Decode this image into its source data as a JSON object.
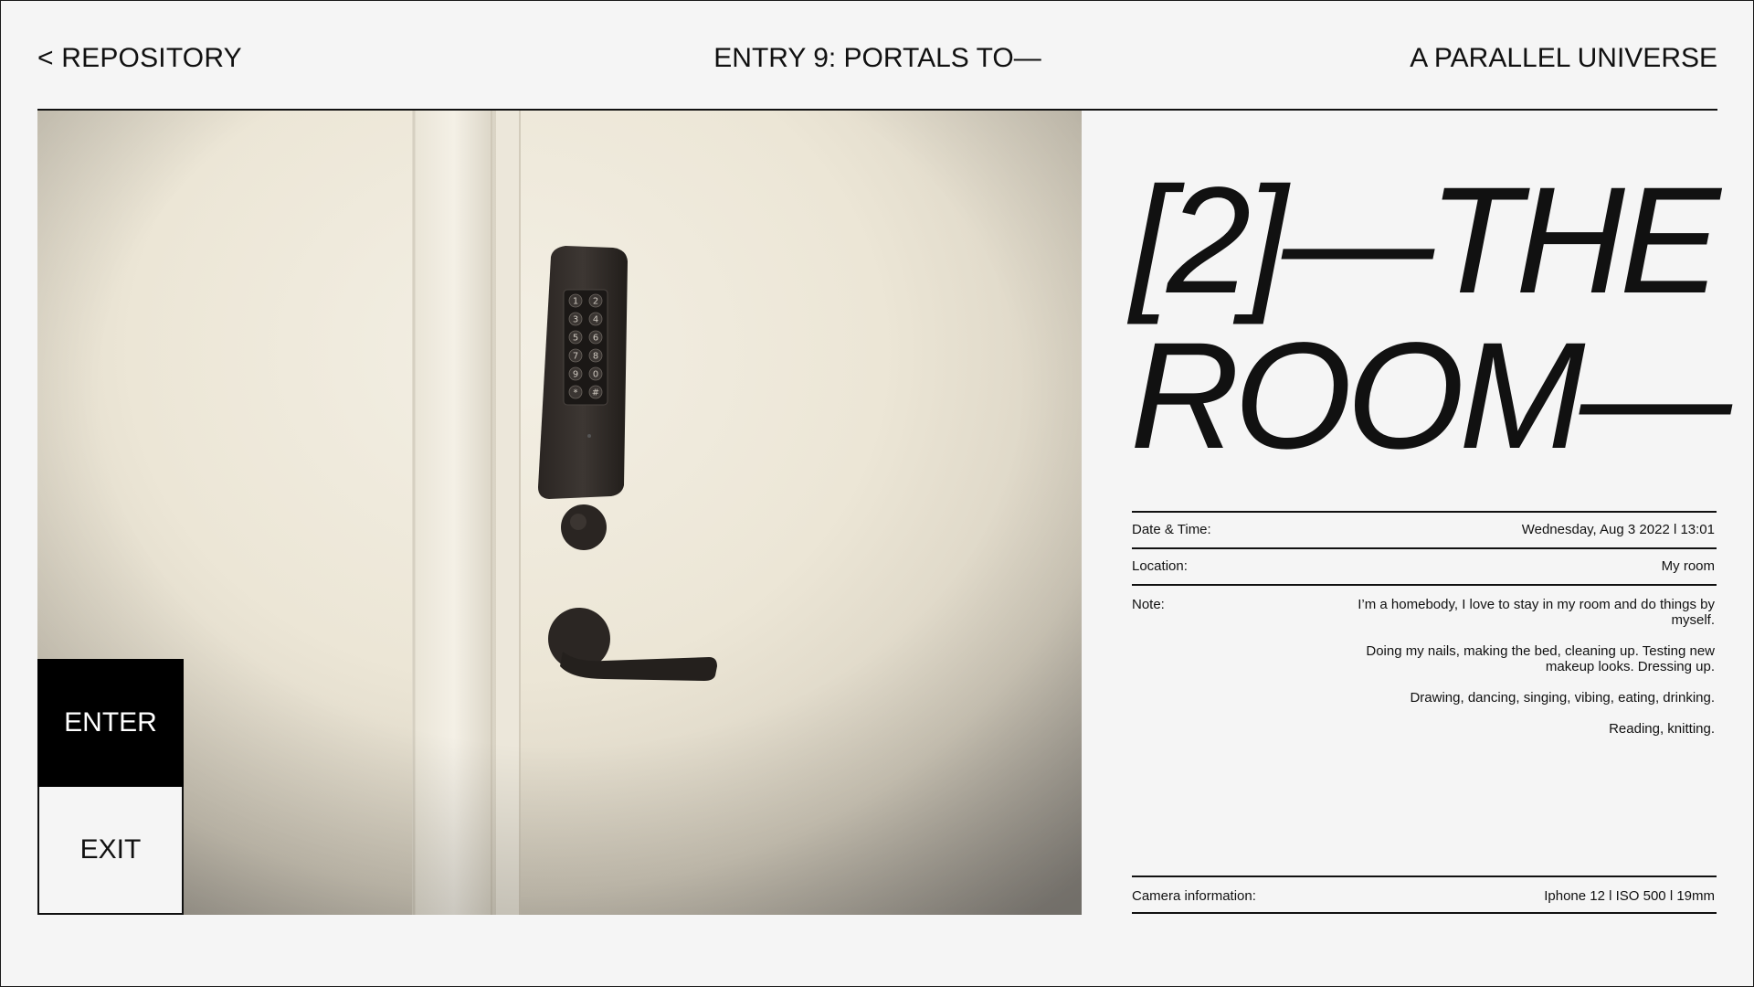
{
  "header": {
    "back_label": "< REPOSITORY",
    "entry_title": "ENTRY 9: PORTALS TO—",
    "site_name": "A PARALLEL UNIVERSE"
  },
  "actions": {
    "enter_label": "ENTER",
    "exit_label": "EXIT"
  },
  "room": {
    "title_line1": "[2]—THE",
    "title_line2": "ROOM—"
  },
  "details": {
    "datetime_label": "Date & Time:",
    "datetime_value": "Wednesday, Aug 3 2022 l 13:01",
    "location_label": "Location:",
    "location_value": "My room",
    "note_label": "Note:",
    "note_paragraphs": [
      "I’m a homebody, I love to stay in my room and do things by myself.",
      "Doing my nails, making the bed, cleaning up. Testing new makeup looks. Dressing up.",
      "Drawing, dancing, singing, vibing, eating, drinking.",
      "Reading, knitting."
    ],
    "camera_label": "Camera information:",
    "camera_value": "Iphone 12 l ISO 500 l 19mm"
  },
  "keypad": {
    "keys": [
      "1",
      "2",
      "3",
      "4",
      "5",
      "6",
      "7",
      "8",
      "9",
      "0",
      "*",
      "#"
    ]
  },
  "colors": {
    "accent": "#000000",
    "background": "#f5f5f5",
    "text": "#111111"
  }
}
